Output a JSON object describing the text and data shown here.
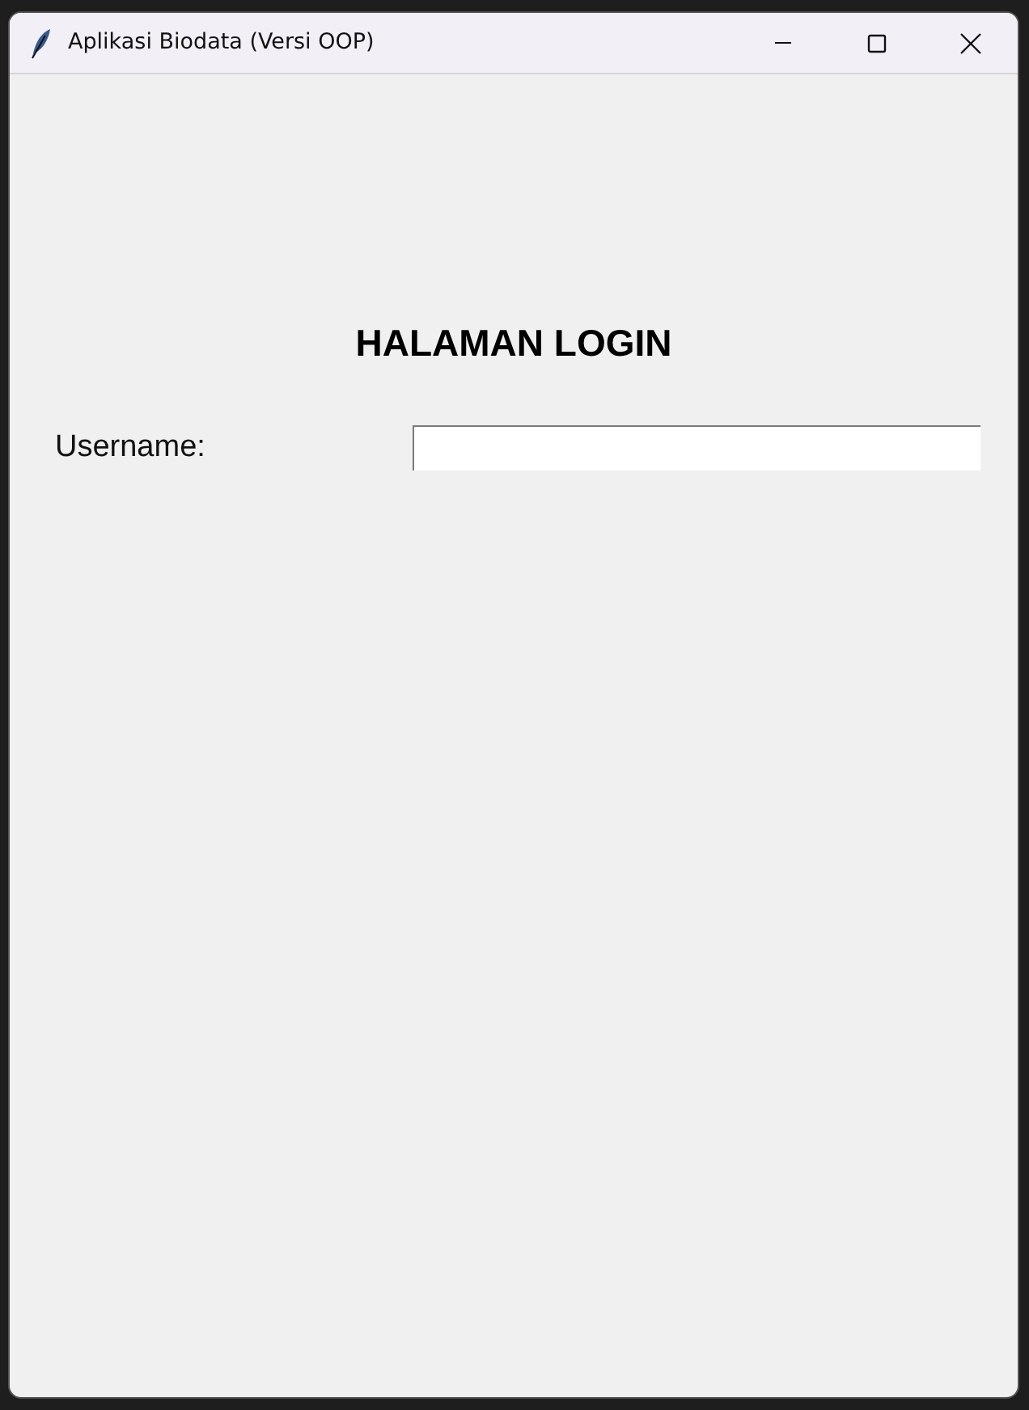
{
  "window": {
    "title": "Aplikasi Biodata (Versi OOP)"
  },
  "heading": "HALAMAN LOGIN",
  "fields": [
    {
      "label": "Username:"
    }
  ]
}
